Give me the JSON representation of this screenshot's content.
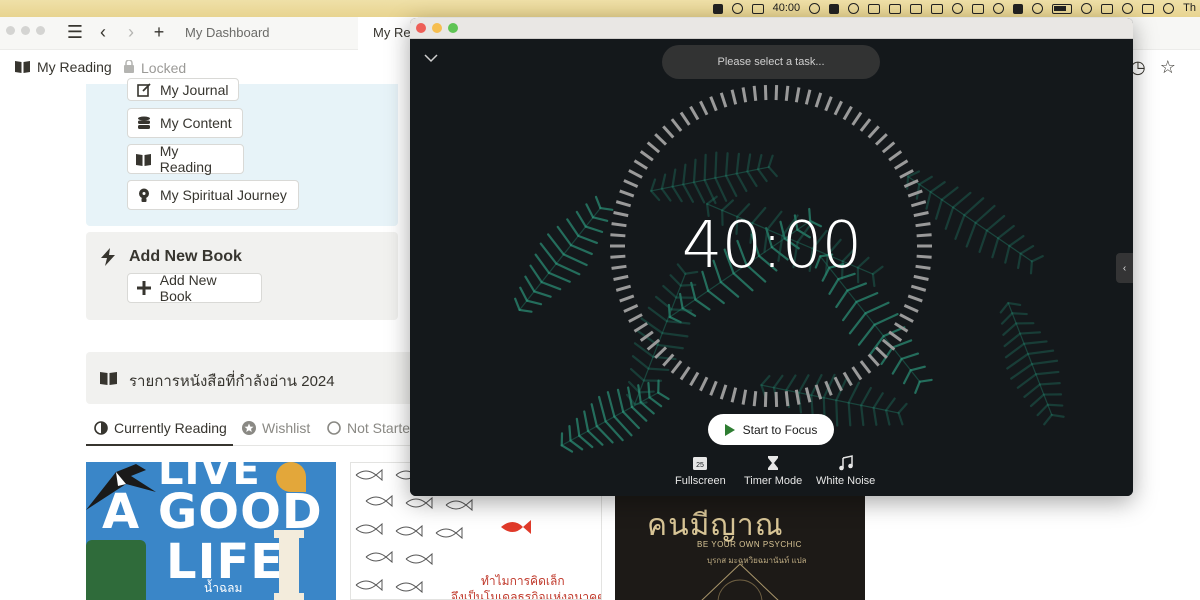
{
  "menubar": {
    "clock": "40:00",
    "user_initials": "Th"
  },
  "notion": {
    "tabs": [
      {
        "label": "My Dashboard"
      },
      {
        "label": "My Re"
      }
    ],
    "breadcrumb": {
      "title": "My Reading",
      "lock_status": "Locked"
    },
    "nav_buttons": [
      {
        "label": "My Journal",
        "icon": "pencil-square-icon"
      },
      {
        "label": "My Content",
        "icon": "database-icon"
      },
      {
        "label": "My Reading",
        "icon": "book-open-icon"
      },
      {
        "label": "My Spiritual Journey",
        "icon": "lightbulb-icon"
      }
    ],
    "add_book": {
      "title": "Add New Book",
      "button_label": "Add New Book"
    },
    "reading_list": {
      "title": "รายการหนังสือที่กำลังอ่าน 2024"
    },
    "view_tabs": [
      {
        "label": "Currently Reading",
        "active": true
      },
      {
        "label": "Wishlist",
        "active": false
      },
      {
        "label": "Not Starte",
        "active": false
      }
    ],
    "covers": [
      {
        "line1": "LIVE",
        "line2": "A GOOD",
        "line3": "LIFE",
        "subtitle": "น้ำฉลม"
      },
      {
        "line1": "ทำไมการคิดเล็ก",
        "line2": "จึงเป็นโมเดลธุรกิจแห่งอนาคต"
      },
      {
        "title": "คนมีญาณ",
        "subtitle": "BE YOUR OWN PSYCHIC",
        "author": "บุรกส มะฉุหวิยฉมานันท์ แปล"
      }
    ]
  },
  "timer": {
    "task_placeholder": "Please select a task...",
    "time": "40:00",
    "start_label": "Start to Focus",
    "controls": [
      {
        "label": "Fullscreen",
        "icon": "fullscreen-icon",
        "badge": "25"
      },
      {
        "label": "Timer Mode",
        "icon": "hourglass-icon"
      },
      {
        "label": "White Noise",
        "icon": "music-note-icon"
      }
    ],
    "colors": {
      "ring": "#9a9a9a",
      "background": "#15191c",
      "fern": "#1f6b5a",
      "play": "#2e7d32"
    },
    "side_handle": "‹"
  },
  "colors": {
    "callout_blue": "#e7f3f8",
    "callout_grey": "#f1f1ef",
    "menubar": "#efe0a8"
  }
}
